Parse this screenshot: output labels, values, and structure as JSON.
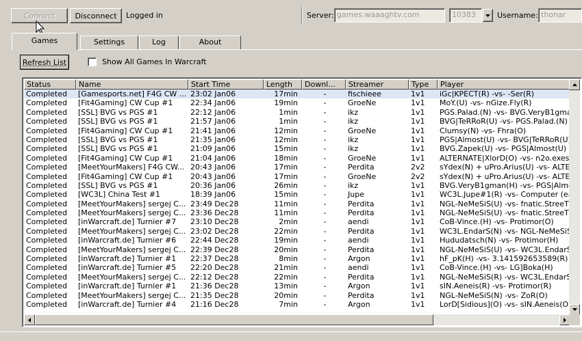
{
  "toolbar": {
    "connect_label": "Connect",
    "disconnect_label": "Disconnect",
    "status_text": "Logged in",
    "server_label": "Server:",
    "server_value": "games.waaaghtv.com",
    "port_value": "10383",
    "username_label": "Username:",
    "username_value": "thonar"
  },
  "tabs": [
    {
      "label": "Games"
    },
    {
      "label": "Settings"
    },
    {
      "label": "Log"
    },
    {
      "label": "About"
    }
  ],
  "games": {
    "refresh_label": "Refresh List",
    "show_all_label": "Show All Games In Warcraft",
    "show_all_checked": false,
    "columns": [
      "Status",
      "Name",
      "Start Time",
      "Length",
      "Downl...",
      "Streamer",
      "Type",
      "Player"
    ],
    "rows": [
      [
        "Completed",
        "[Gamesports.net] F4G CW ...",
        "23:02 Jan06",
        "17min",
        "-",
        "fischieee",
        "1v1",
        "iGc|KPECT(R) -vs- -Ser(R)"
      ],
      [
        "Completed",
        "[Fit4Gaming] CW Cup #1",
        "22:34 Jan06",
        "19min",
        "-",
        "GroeNe",
        "1v1",
        "MoY.(U) -vs- nGize.Fly(R)"
      ],
      [
        "Completed",
        "[SSL] BVG vs PGS #1",
        "22:12 Jan06",
        "1min",
        "-",
        "ikz",
        "1v1",
        "PGS.Palad.(N) -vs- BVG.VeryB1gman"
      ],
      [
        "Completed",
        "[SSL] BVG vs PGS #1",
        "21:57 Jan06",
        "1min",
        "-",
        "ikz",
        "1v1",
        "BVG|TeRRoR(U) -vs- PGS.Palad.(N)"
      ],
      [
        "Completed",
        "[Fit4Gaming] CW Cup #1",
        "21:41 Jan06",
        "12min",
        "-",
        "GroeNe",
        "1v1",
        "Clumsy(N) -vs- Fhra(O)"
      ],
      [
        "Completed",
        "[SSL] BVG vs PGS #1",
        "21:35 Jan06",
        "12min",
        "-",
        "ikz",
        "1v1",
        "PGS|Almost(U) -vs- BVG|TeRRoR(U)"
      ],
      [
        "Completed",
        "[SSL] BVG vs PGS #1",
        "21:09 Jan06",
        "15min",
        "-",
        "ikz",
        "1v1",
        "BVG.Zapek(U) -vs- PGS|Almost(U)"
      ],
      [
        "Completed",
        "[Fit4Gaming] CW Cup #1",
        "21:04 Jan06",
        "18min",
        "-",
        "GroeNe",
        "1v1",
        "ALTERNATE|XlorD(O) -vs- n2o.exesl"
      ],
      [
        "Completed",
        "[MeetYourMakers] F4G CW...",
        "20:43 Jan06",
        "17min",
        "-",
        "Perdita",
        "2v2",
        "sYdex(N) + uPro.Arius(U) -vs- ALTER"
      ],
      [
        "Completed",
        "[Fit4Gaming] CW Cup #1",
        "20:43 Jan06",
        "17min",
        "-",
        "GroeNe",
        "2v2",
        "sYdex(N) + uPro.Arius(U) -vs- ALTER"
      ],
      [
        "Completed",
        "[SSL] BVG vs PGS #1",
        "20:36 Jan06",
        "26min",
        "-",
        "ikz",
        "1v1",
        "BVG.VeryB1gman(H) -vs- PGS|Almos"
      ],
      [
        "Completed",
        "[WC3L] China Test #1",
        "18:39 Jan06",
        "15min",
        "-",
        "Jupe",
        "1v1",
        "WC3L.Jupe#1(R) -vs- Computer (ea"
      ],
      [
        "Completed",
        "[MeetYourMakers] sergej C...",
        "23:49 Dec28",
        "11min",
        "-",
        "Perdita",
        "1v1",
        "NGL-NeMeSiS(U) -vs- fnatic.StreeT(H"
      ],
      [
        "Completed",
        "[MeetYourMakers] sergej C...",
        "23:36 Dec28",
        "11min",
        "-",
        "Perdita",
        "1v1",
        "NGL-NeMeSiS(U) -vs- fnatic.StreeT(H"
      ],
      [
        "Completed",
        "[inWarcraft.de] Turnier #7",
        "23:10 Dec28",
        "2min",
        "-",
        "aendi",
        "1v1",
        "CoB-Vince.(H) -vs- Protimor(O)"
      ],
      [
        "Completed",
        "[MeetYourMakers] sergej C...",
        "23:02 Dec28",
        "22min",
        "-",
        "Perdita",
        "1v1",
        "WC3L.EndarS(N) -vs- NGL-NeMeSiS("
      ],
      [
        "Completed",
        "[inWarcraft.de] Turnier #6",
        "22:44 Dec28",
        "19min",
        "-",
        "aendi",
        "1v1",
        "Hududatsch(N) -vs- Protimor(H)"
      ],
      [
        "Completed",
        "[MeetYourMakers] sergej C...",
        "22:39 Dec28",
        "20min",
        "-",
        "Perdita",
        "1v1",
        "NGL-NeMeSiS(U) -vs- WC3L.EndarS("
      ],
      [
        "Completed",
        "[inWarcraft.de] Turnier #1",
        "22:37 Dec28",
        "8min",
        "-",
        "Argon",
        "1v1",
        "hF_pK(H) -vs- 3.141592653589(R)"
      ],
      [
        "Completed",
        "[inWarcraft.de] Turnier #5",
        "22:20 Dec28",
        "21min",
        "-",
        "aendi",
        "1v1",
        "CoB-Vince.(H) -vs- LG]Boka(H)"
      ],
      [
        "Completed",
        "[MeetYourMakers] sergej C...",
        "22:12 Dec28",
        "22min",
        "-",
        "Perdita",
        "1v1",
        "NGL-NeMeSiS(R) -vs- WC3L.EndarS("
      ],
      [
        "Completed",
        "[inWarcraft.de] Turnier #1",
        "21:36 Dec28",
        "13min",
        "-",
        "Argon",
        "1v1",
        "sIN.Aeneis(R) -vs- Protimor(R)"
      ],
      [
        "Completed",
        "[MeetYourMakers] sergej C...",
        "21:35 Dec28",
        "20min",
        "-",
        "Perdita",
        "1v1",
        "NGL-NeMeSiS(N) -vs- ZoR(O)"
      ],
      [
        "Completed",
        "[inWarcraft.de] Turnier #4",
        "21:16 Dec28",
        "7min",
        "-",
        "Argon",
        "1v1",
        "LorD[Sidious](O) -vs- sIN.Aeneis(O)"
      ]
    ]
  }
}
